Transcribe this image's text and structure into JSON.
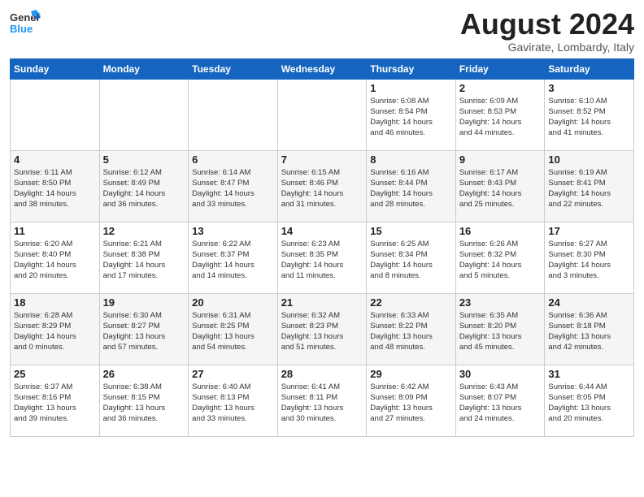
{
  "header": {
    "logo_line1": "General",
    "logo_line2": "Blue",
    "month_year": "August 2024",
    "location": "Gavirate, Lombardy, Italy"
  },
  "days_of_week": [
    "Sunday",
    "Monday",
    "Tuesday",
    "Wednesday",
    "Thursday",
    "Friday",
    "Saturday"
  ],
  "weeks": [
    [
      {
        "day": "",
        "info": ""
      },
      {
        "day": "",
        "info": ""
      },
      {
        "day": "",
        "info": ""
      },
      {
        "day": "",
        "info": ""
      },
      {
        "day": "1",
        "info": "Sunrise: 6:08 AM\nSunset: 8:54 PM\nDaylight: 14 hours\nand 46 minutes."
      },
      {
        "day": "2",
        "info": "Sunrise: 6:09 AM\nSunset: 8:53 PM\nDaylight: 14 hours\nand 44 minutes."
      },
      {
        "day": "3",
        "info": "Sunrise: 6:10 AM\nSunset: 8:52 PM\nDaylight: 14 hours\nand 41 minutes."
      }
    ],
    [
      {
        "day": "4",
        "info": "Sunrise: 6:11 AM\nSunset: 8:50 PM\nDaylight: 14 hours\nand 38 minutes."
      },
      {
        "day": "5",
        "info": "Sunrise: 6:12 AM\nSunset: 8:49 PM\nDaylight: 14 hours\nand 36 minutes."
      },
      {
        "day": "6",
        "info": "Sunrise: 6:14 AM\nSunset: 8:47 PM\nDaylight: 14 hours\nand 33 minutes."
      },
      {
        "day": "7",
        "info": "Sunrise: 6:15 AM\nSunset: 8:46 PM\nDaylight: 14 hours\nand 31 minutes."
      },
      {
        "day": "8",
        "info": "Sunrise: 6:16 AM\nSunset: 8:44 PM\nDaylight: 14 hours\nand 28 minutes."
      },
      {
        "day": "9",
        "info": "Sunrise: 6:17 AM\nSunset: 8:43 PM\nDaylight: 14 hours\nand 25 minutes."
      },
      {
        "day": "10",
        "info": "Sunrise: 6:19 AM\nSunset: 8:41 PM\nDaylight: 14 hours\nand 22 minutes."
      }
    ],
    [
      {
        "day": "11",
        "info": "Sunrise: 6:20 AM\nSunset: 8:40 PM\nDaylight: 14 hours\nand 20 minutes."
      },
      {
        "day": "12",
        "info": "Sunrise: 6:21 AM\nSunset: 8:38 PM\nDaylight: 14 hours\nand 17 minutes."
      },
      {
        "day": "13",
        "info": "Sunrise: 6:22 AM\nSunset: 8:37 PM\nDaylight: 14 hours\nand 14 minutes."
      },
      {
        "day": "14",
        "info": "Sunrise: 6:23 AM\nSunset: 8:35 PM\nDaylight: 14 hours\nand 11 minutes."
      },
      {
        "day": "15",
        "info": "Sunrise: 6:25 AM\nSunset: 8:34 PM\nDaylight: 14 hours\nand 8 minutes."
      },
      {
        "day": "16",
        "info": "Sunrise: 6:26 AM\nSunset: 8:32 PM\nDaylight: 14 hours\nand 5 minutes."
      },
      {
        "day": "17",
        "info": "Sunrise: 6:27 AM\nSunset: 8:30 PM\nDaylight: 14 hours\nand 3 minutes."
      }
    ],
    [
      {
        "day": "18",
        "info": "Sunrise: 6:28 AM\nSunset: 8:29 PM\nDaylight: 14 hours\nand 0 minutes."
      },
      {
        "day": "19",
        "info": "Sunrise: 6:30 AM\nSunset: 8:27 PM\nDaylight: 13 hours\nand 57 minutes."
      },
      {
        "day": "20",
        "info": "Sunrise: 6:31 AM\nSunset: 8:25 PM\nDaylight: 13 hours\nand 54 minutes."
      },
      {
        "day": "21",
        "info": "Sunrise: 6:32 AM\nSunset: 8:23 PM\nDaylight: 13 hours\nand 51 minutes."
      },
      {
        "day": "22",
        "info": "Sunrise: 6:33 AM\nSunset: 8:22 PM\nDaylight: 13 hours\nand 48 minutes."
      },
      {
        "day": "23",
        "info": "Sunrise: 6:35 AM\nSunset: 8:20 PM\nDaylight: 13 hours\nand 45 minutes."
      },
      {
        "day": "24",
        "info": "Sunrise: 6:36 AM\nSunset: 8:18 PM\nDaylight: 13 hours\nand 42 minutes."
      }
    ],
    [
      {
        "day": "25",
        "info": "Sunrise: 6:37 AM\nSunset: 8:16 PM\nDaylight: 13 hours\nand 39 minutes."
      },
      {
        "day": "26",
        "info": "Sunrise: 6:38 AM\nSunset: 8:15 PM\nDaylight: 13 hours\nand 36 minutes."
      },
      {
        "day": "27",
        "info": "Sunrise: 6:40 AM\nSunset: 8:13 PM\nDaylight: 13 hours\nand 33 minutes."
      },
      {
        "day": "28",
        "info": "Sunrise: 6:41 AM\nSunset: 8:11 PM\nDaylight: 13 hours\nand 30 minutes."
      },
      {
        "day": "29",
        "info": "Sunrise: 6:42 AM\nSunset: 8:09 PM\nDaylight: 13 hours\nand 27 minutes."
      },
      {
        "day": "30",
        "info": "Sunrise: 6:43 AM\nSunset: 8:07 PM\nDaylight: 13 hours\nand 24 minutes."
      },
      {
        "day": "31",
        "info": "Sunrise: 6:44 AM\nSunset: 8:05 PM\nDaylight: 13 hours\nand 20 minutes."
      }
    ]
  ]
}
